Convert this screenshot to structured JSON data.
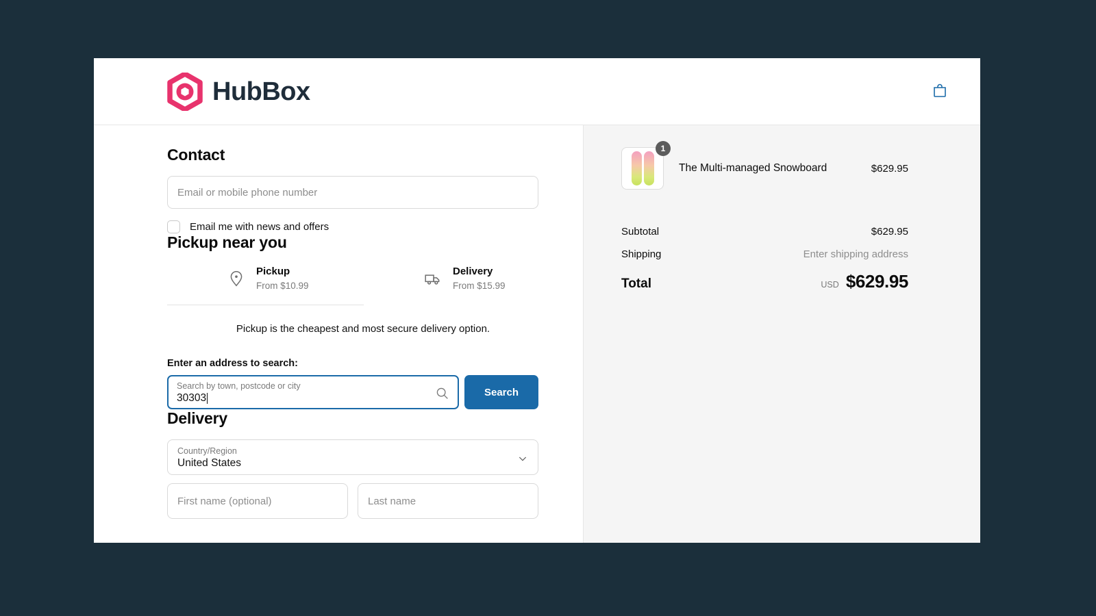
{
  "header": {
    "brand_name": "HubBox",
    "logo_icon": "hexagon-logo-icon",
    "logo_color": "#e8336d",
    "cart_icon": "shopping-bag-icon",
    "cart_icon_color": "#1a6aa8"
  },
  "contact": {
    "title": "Contact",
    "email_placeholder": "Email or mobile phone number",
    "email_value": "",
    "newsletter_label": "Email me with news and offers",
    "newsletter_checked": false
  },
  "pickup": {
    "title": "Pickup near you",
    "tabs": [
      {
        "label": "Pickup",
        "sub": "From $10.99",
        "icon": "map-pin-icon",
        "active": true
      },
      {
        "label": "Delivery",
        "sub": "From $15.99",
        "icon": "truck-icon",
        "active": false
      }
    ],
    "helper_note": "Pickup is the cheapest and most secure delivery option.",
    "search_label": "Enter an address to search:",
    "search_float_label": "Search by town, postcode or city",
    "search_value": "30303",
    "search_icon": "magnifier-icon",
    "search_button": "Search",
    "accent_color": "#1a6aa8"
  },
  "delivery": {
    "title": "Delivery",
    "country_label": "Country/Region",
    "country_value": "United States",
    "chevron_icon": "chevron-down-icon",
    "first_name_placeholder": "First name (optional)",
    "last_name_placeholder": "Last name"
  },
  "summary": {
    "item": {
      "name": "The Multi-managed Snowboard",
      "price": "$629.95",
      "quantity": "1",
      "image_alt": "snowboard-thumbnail"
    },
    "rows": [
      {
        "label": "Subtotal",
        "value": "$629.95",
        "muted": false
      },
      {
        "label": "Shipping",
        "value": "Enter shipping address",
        "muted": true
      }
    ],
    "total_label": "Total",
    "total_currency": "USD",
    "total_value": "$629.95"
  }
}
